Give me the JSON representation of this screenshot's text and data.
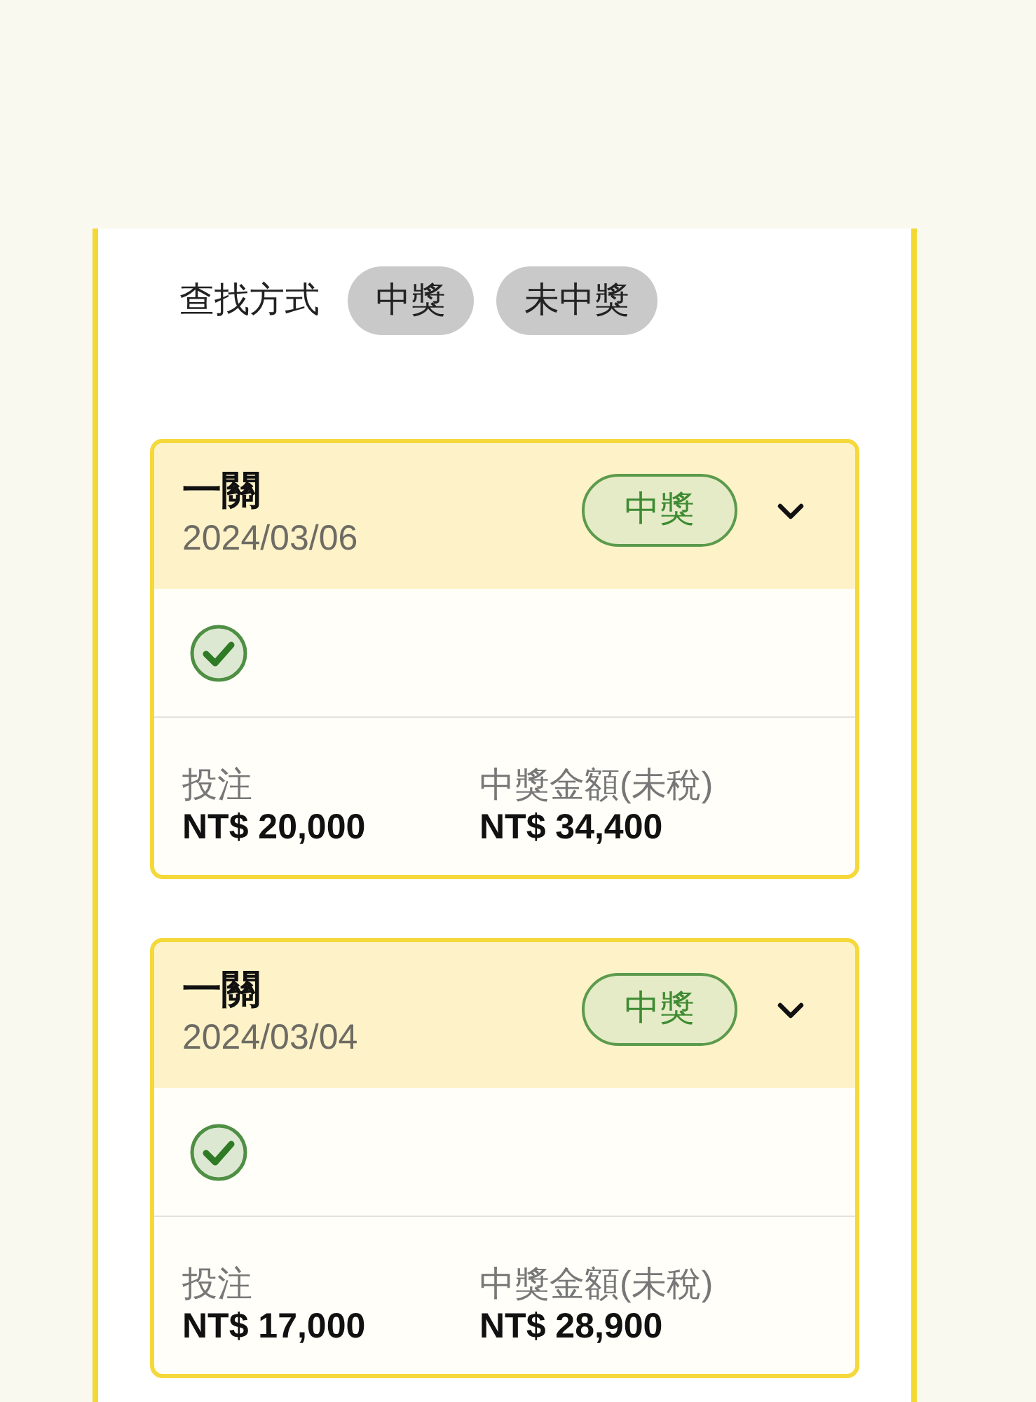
{
  "filter": {
    "label": "查找方式",
    "options": [
      {
        "label": "中獎",
        "selected": false
      },
      {
        "label": "未中獎",
        "selected": false
      }
    ]
  },
  "records": [
    {
      "title": "一關",
      "date": "2024/03/06",
      "status": {
        "kind": "won",
        "label": "中獎"
      },
      "stake": {
        "label": "投注",
        "value": "NT$ 20,000"
      },
      "payout": {
        "label": "中獎金額(未稅)",
        "value": "NT$ 34,400"
      }
    },
    {
      "title": "一關",
      "date": "2024/03/04",
      "status": {
        "kind": "won",
        "label": "中獎"
      },
      "stake": {
        "label": "投注",
        "value": "NT$ 17,000"
      },
      "payout": {
        "label": "中獎金額(未稅)",
        "value": "NT$ 28,900"
      }
    }
  ]
}
